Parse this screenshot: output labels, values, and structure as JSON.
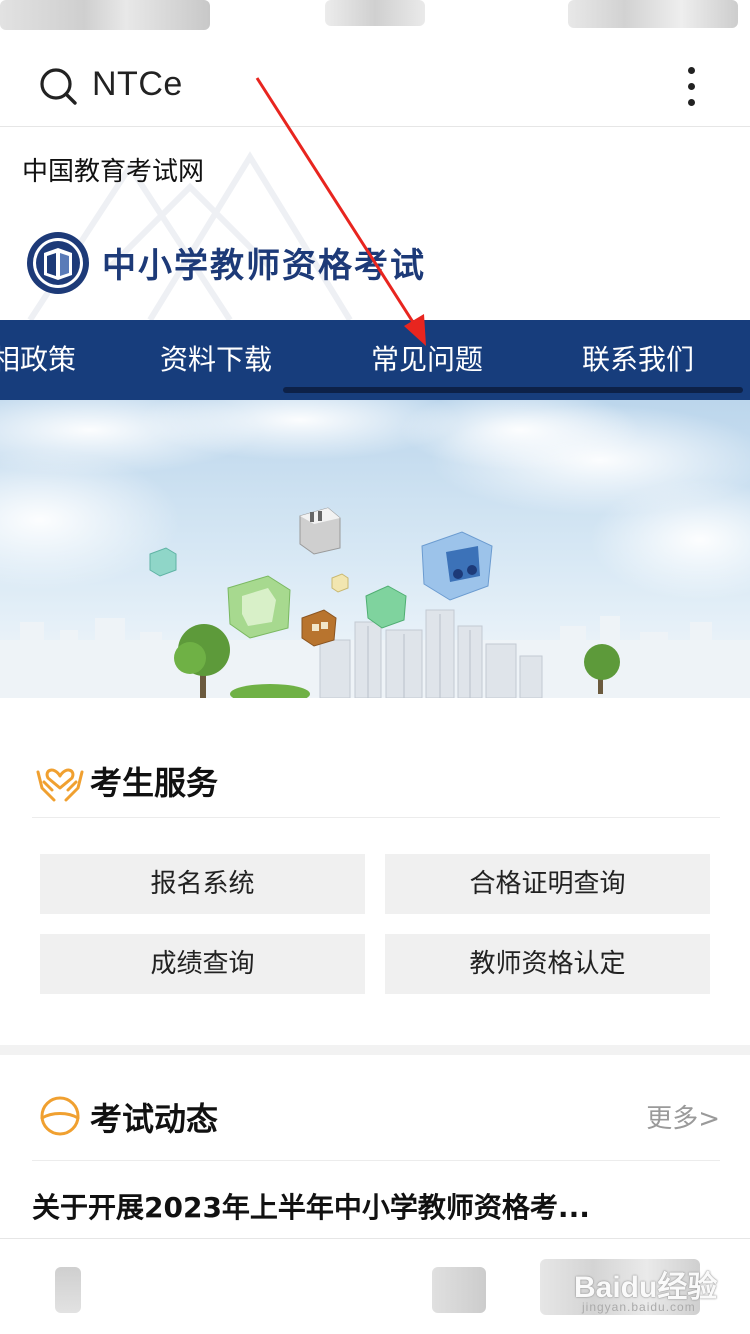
{
  "header": {
    "search_text": "NTCe"
  },
  "site": {
    "name": "中国教育考试网",
    "title": "中小学教师资格考试"
  },
  "nav": {
    "items": [
      "相政策",
      "资料下载",
      "常见问题",
      "联系我们"
    ]
  },
  "services": {
    "title": "考生服务",
    "buttons": [
      "报名系统",
      "合格证明查询",
      "成绩查询",
      "教师资格认定"
    ]
  },
  "news": {
    "title": "考试动态",
    "more_label": "更多>",
    "items": [
      "关于开展2023年上半年中小学教师资格考..."
    ]
  },
  "watermark": {
    "text": "Baidu经验",
    "sub": "jingyan.baidu.com"
  },
  "colors": {
    "nav_bg": "#173d7c",
    "title_blue": "#1d3a78",
    "accent_orange": "#f0a030",
    "annotation_red": "#e8251f"
  }
}
